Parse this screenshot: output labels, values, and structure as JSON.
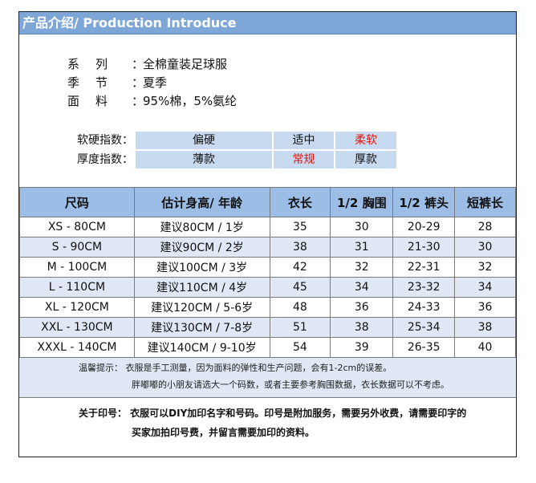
{
  "header": {
    "title": "产品介绍/ Production Introduce"
  },
  "specs": [
    {
      "label": "系列",
      "value": "全棉童装足球服"
    },
    {
      "label": "季节",
      "value": "夏季"
    },
    {
      "label": "面料",
      "value": "95%棉，5%氨纶"
    }
  ],
  "colon": "：",
  "hardness": {
    "label": "软硬指数：",
    "options": [
      "偏硬",
      "适中",
      "柔软"
    ],
    "selected": "柔软"
  },
  "thickness": {
    "label": "厚度指数：",
    "options": [
      "薄款",
      "常规",
      "厚款"
    ],
    "selected": "常规"
  },
  "size_table": {
    "headers": [
      "尺码",
      "估计身高/ 年龄",
      "衣长",
      "1/2 胸围",
      "1/2 裤头",
      "短裤长"
    ],
    "rows": [
      [
        "XS  -  80CM",
        "建议80CM / 1岁",
        "35",
        "30",
        "20-29",
        "28"
      ],
      [
        "S   -  90CM",
        "建议90CM / 2岁",
        "38",
        "31",
        "21-30",
        "30"
      ],
      [
        "M  - 100CM",
        "建议100CM / 3岁",
        "42",
        "32",
        "22-31",
        "32"
      ],
      [
        "L  - 110CM",
        "建议110CM / 4岁",
        "45",
        "34",
        "23-32",
        "34"
      ],
      [
        "XL - 120CM",
        "建议120CM / 5-6岁",
        "48",
        "36",
        "24-33",
        "36"
      ],
      [
        "XXL - 130CM",
        "建议130CM / 7-8岁",
        "51",
        "38",
        "25-34",
        "38"
      ],
      [
        "XXXL - 140CM",
        "建议140CM / 9-10岁",
        "54",
        "39",
        "26-35",
        "40"
      ]
    ]
  },
  "notes": {
    "line1": "温馨提示：  衣服是手工测量，因为面料的弹性和生产问题，会有1-2cm的误差。",
    "line2": "胖嘟嘟的小朋友请选大一个码数，或者主要参考胸围数据，衣长数据可以不考虑。"
  },
  "printing": {
    "line1": "关于印号：  衣服可以DIY加印名字和号码。印号是附加服务，需要另外收费，请需要印字的",
    "line2": "买家加拍印号费，并留言需要加印的资料。"
  },
  "colors": {
    "header_bg": "#7ea7d8",
    "table_header_bg": "#9bbde6",
    "alt_row_bg": "#dfe8f4",
    "highlight_red": "#e8120c"
  }
}
